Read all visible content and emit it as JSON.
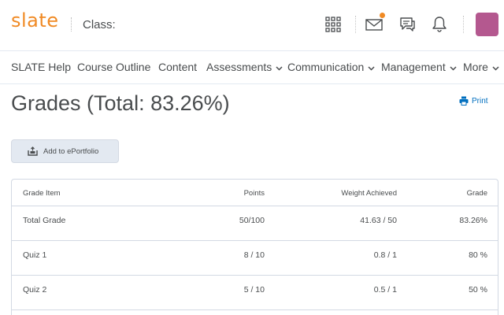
{
  "header": {
    "logo_text": "slate",
    "class_label": "Class:",
    "accent_color": "#f08a24",
    "avatar_color": "#b4588f",
    "icons": [
      "waffle-icon",
      "mail-icon",
      "chat-icon",
      "bell-icon"
    ]
  },
  "nav": {
    "items": [
      {
        "label": "SLATE Help"
      },
      {
        "label": "Course Outline"
      },
      {
        "label": "Content"
      },
      {
        "label": "Assessments"
      },
      {
        "label": "Communication"
      },
      {
        "label": "Management"
      },
      {
        "label": "More"
      }
    ]
  },
  "page": {
    "title": "Grades (Total: 83.26%)",
    "print_label": "Print",
    "portfolio_button": "Add to ePortfolio"
  },
  "grades": {
    "columns": [
      "Grade Item",
      "Points",
      "Weight Achieved",
      "Grade"
    ],
    "rows": [
      {
        "item": "Total Grade",
        "points": "50/100",
        "weight": "41.63 / 50",
        "grade": "83.26%"
      },
      {
        "item": "Quiz 1",
        "points": "8 / 10",
        "weight": "0.8 / 1",
        "grade": "80 %"
      },
      {
        "item": "Quiz 2",
        "points": "5 / 10",
        "weight": "0.5 / 1",
        "grade": "50 %"
      }
    ]
  }
}
